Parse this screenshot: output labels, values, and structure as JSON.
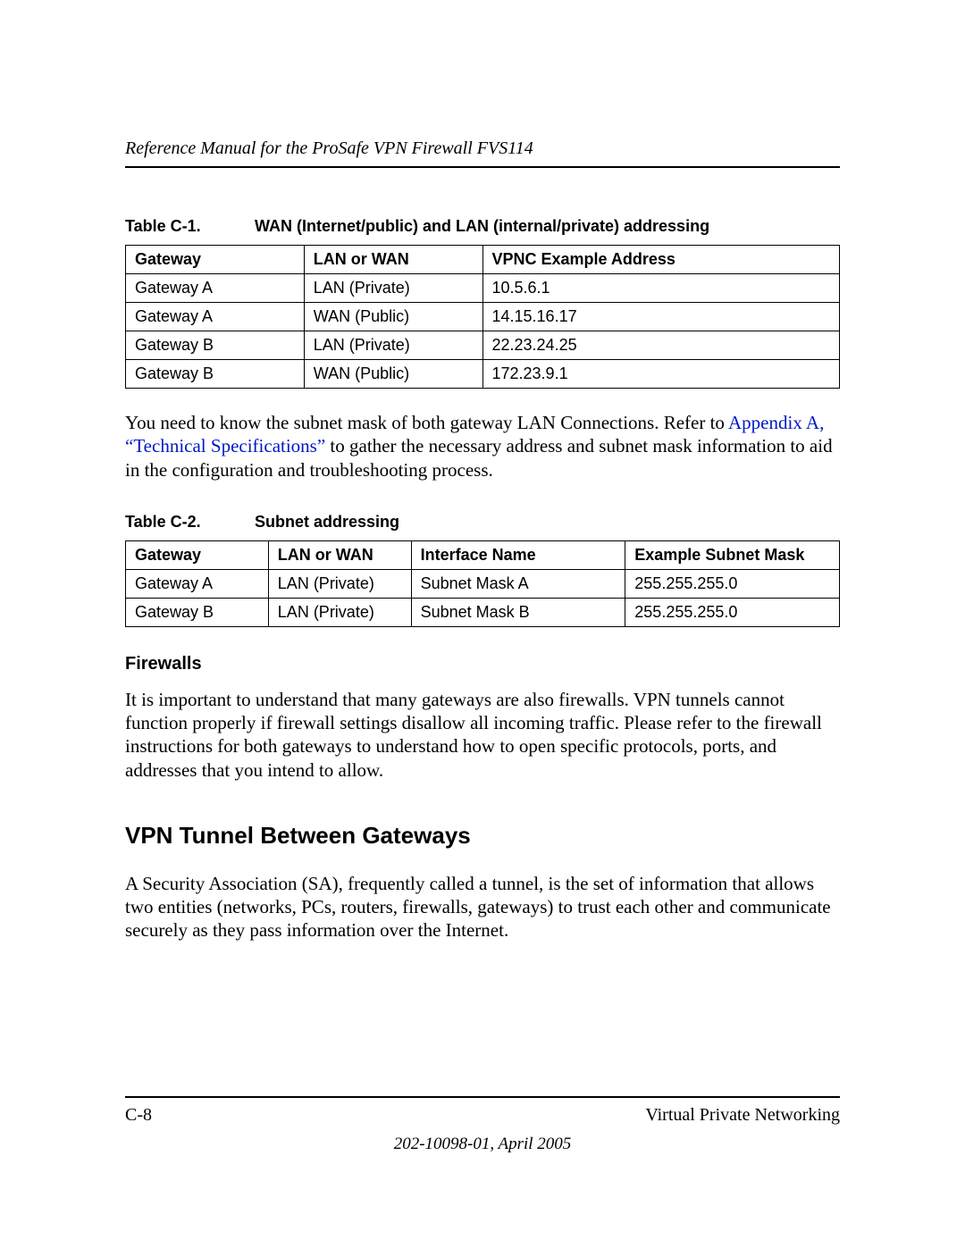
{
  "header": {
    "running_title": "Reference Manual for the ProSafe VPN Firewall FVS114"
  },
  "table1": {
    "label_num": "Table C-1.",
    "label_title": "WAN (Internet/public) and LAN (internal/private) addressing",
    "headers": {
      "c1": "Gateway",
      "c2": "LAN or WAN",
      "c3": "VPNC Example Address"
    },
    "rows": [
      {
        "c1": "Gateway A",
        "c2": "LAN (Private)",
        "c3": "10.5.6.1"
      },
      {
        "c1": "Gateway A",
        "c2": "WAN (Public)",
        "c3": "14.15.16.17"
      },
      {
        "c1": "Gateway B",
        "c2": "LAN (Private)",
        "c3": "22.23.24.25"
      },
      {
        "c1": "Gateway B",
        "c2": "WAN (Public)",
        "c3": "172.23.9.1"
      }
    ]
  },
  "para1": {
    "pre": "You need to know the subnet mask of both gateway LAN Connections. Refer to ",
    "link": "Appendix A, “Technical Specifications”",
    "post": " to gather the necessary address and subnet mask information to aid in the configuration and troubleshooting process."
  },
  "table2": {
    "label_num": "Table C-2.",
    "label_title": "Subnet addressing",
    "headers": {
      "c1": "Gateway",
      "c2": "LAN or WAN",
      "c3": "Interface Name",
      "c4": "Example Subnet Mask"
    },
    "rows": [
      {
        "c1": "Gateway A",
        "c2": "LAN (Private)",
        "c3": "Subnet Mask A",
        "c4": "255.255.255.0"
      },
      {
        "c1": "Gateway B",
        "c2": "LAN (Private)",
        "c3": "Subnet Mask B",
        "c4": "255.255.255.0"
      }
    ]
  },
  "sections": {
    "firewalls_heading": "Firewalls",
    "firewalls_body": "It is important to understand that many gateways are also firewalls. VPN tunnels cannot function properly if firewall settings disallow all incoming traffic. Please refer to the firewall instructions for both gateways to understand how to open specific protocols, ports, and addresses that you intend to allow.",
    "vpn_heading": "VPN Tunnel Between Gateways",
    "vpn_body": "A Security Association (SA), frequently called a tunnel, is the set of information that allows two entities (networks, PCs, routers, firewalls, gateways) to trust each other and communicate securely as they pass information over the Internet."
  },
  "footer": {
    "page_num": "C-8",
    "section_title": "Virtual Private Networking",
    "doc_rev": "202-10098-01, April 2005"
  }
}
